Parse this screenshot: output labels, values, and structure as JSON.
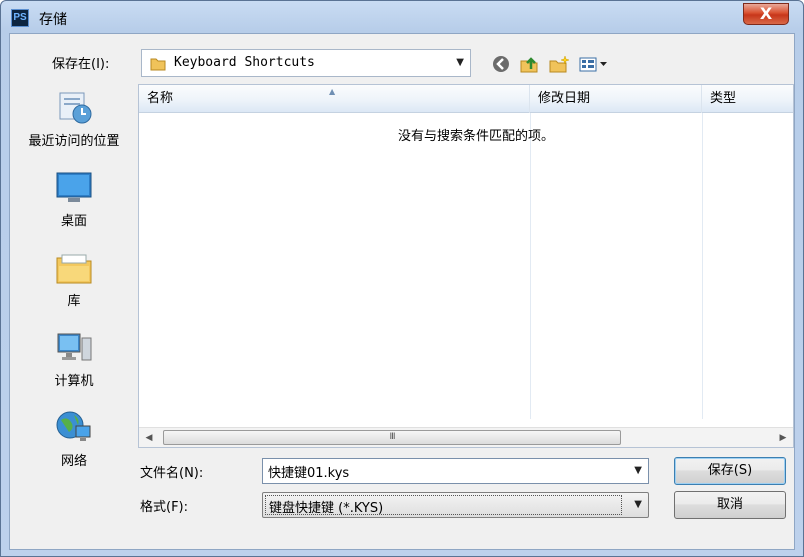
{
  "window": {
    "app_icon": "PS",
    "title": "存储",
    "close_label": "X"
  },
  "location": {
    "label": "保存在(I):",
    "value": "Keyboard Shortcuts",
    "toolbar_icons": [
      "back-icon",
      "up-folder-icon",
      "new-folder-icon",
      "view-menu-icon"
    ]
  },
  "places": [
    {
      "label": "最近访问的位置",
      "icon": "recent-places-icon"
    },
    {
      "label": "桌面",
      "icon": "desktop-icon"
    },
    {
      "label": "库",
      "icon": "libraries-icon"
    },
    {
      "label": "计算机",
      "icon": "computer-icon"
    },
    {
      "label": "网络",
      "icon": "network-icon"
    }
  ],
  "file_list": {
    "columns": [
      "名称",
      "修改日期",
      "类型"
    ],
    "empty_message": "没有与搜索条件匹配的项。",
    "scroll_thumb_grip": "III"
  },
  "filename": {
    "label": "文件名(N):",
    "value": "快捷键01.kys"
  },
  "format": {
    "label": "格式(F):",
    "selected": "键盘快捷键  (*.KYS)"
  },
  "buttons": {
    "save": "保存(S)",
    "cancel": "取消"
  },
  "colors": {
    "title_gradient": "#c9dcf3",
    "close_red": "#c7361a",
    "primary_focus": "#3c7fb1"
  }
}
